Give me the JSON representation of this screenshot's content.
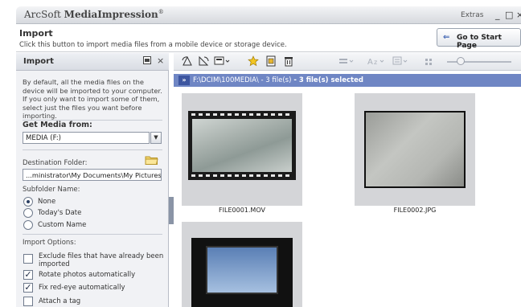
{
  "window": {
    "app_title_prefix": "ArcSoft ",
    "app_title_bold": "MediaImpression",
    "app_title_mark": "®",
    "extras": "Extras",
    "min_glyph": "_",
    "max_glyph": "□",
    "close_glyph": "×"
  },
  "header": {
    "title": "Import",
    "description": "Click this button to import media files from a mobile device or storage device.",
    "start_button": "Go to Start Page",
    "start_arrow": "⇐"
  },
  "panel": {
    "title": "Import",
    "intro": "By default, all the media files on the device will be imported to your computer. If you only want to import some of them, select just the files you want before importing.",
    "get_media_label": "Get Media from:",
    "media_source": "MEDIA (F:)",
    "destination_label": "Destination Folder:",
    "destination_value": "...ministrator\\My Documents\\My Pictures",
    "subfolder_label": "Subfolder Name:",
    "subfolder_options": [
      {
        "label": "None",
        "selected": true
      },
      {
        "label": "Today's Date",
        "selected": false
      },
      {
        "label": "Custom Name",
        "selected": false
      }
    ],
    "import_options_label": "Import Options:",
    "options": [
      {
        "label_line1": "Exclude files that have already been",
        "label_line2": "imported",
        "checked": false
      },
      {
        "label_line1": "Rotate photos automatically",
        "label_line2": "",
        "checked": true
      },
      {
        "label_line1": "Fix red-eye automatically",
        "label_line2": "",
        "checked": true
      },
      {
        "label_line1": "Attach a tag",
        "label_line2": "",
        "checked": false
      }
    ]
  },
  "pathbar": {
    "path": "F:\\DCIM\\100MEDIA\\ - 3 file(s)",
    "selected": " - 3 file(s) selected"
  },
  "files": [
    {
      "name": "FILE0001.MOV",
      "type": "video"
    },
    {
      "name": "FILE0002.JPG",
      "type": "photo"
    },
    {
      "name": "",
      "type": "photo"
    }
  ],
  "colors": {
    "pathbar": "#6f86c4",
    "accent": "#3a5fb0"
  }
}
